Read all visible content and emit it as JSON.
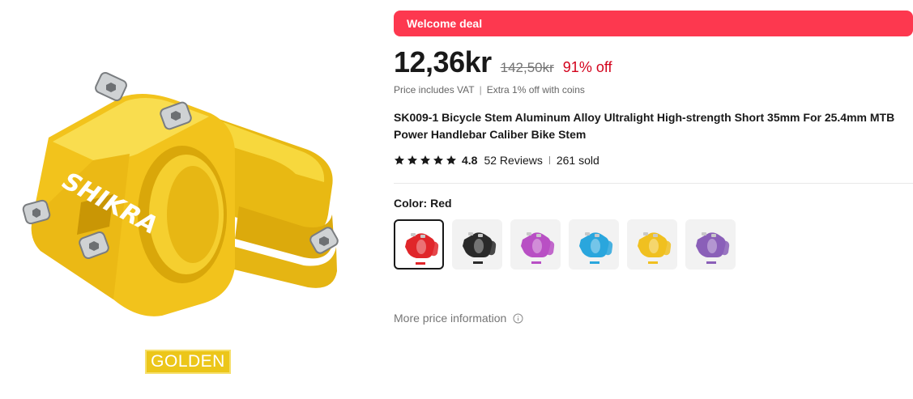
{
  "product": {
    "image_label": "GOLDEN",
    "brand_mark": "SHIKRA"
  },
  "promo": {
    "banner": "Welcome deal"
  },
  "price": {
    "current": "12,36kr",
    "original": "142,50kr",
    "discount": "91% off",
    "vat_note": "Price includes VAT",
    "separator": "|",
    "coins_note": "Extra 1% off with coins"
  },
  "title": "SK009-1 Bicycle Stem Aluminum Alloy Ultralight High-strength Short 35mm For 25.4mm MTB Power Handlebar Caliber Bike Stem",
  "rating": {
    "stars": 5,
    "value": "4.8",
    "reviews": "52 Reviews",
    "sold": "261 sold"
  },
  "color": {
    "label": "Color: Red",
    "options": [
      {
        "name": "red",
        "hex": "#e0262a",
        "selected": true
      },
      {
        "name": "black",
        "hex": "#2a2a2a",
        "selected": false
      },
      {
        "name": "purple",
        "hex": "#b84fc4",
        "selected": false
      },
      {
        "name": "blue",
        "hex": "#2aa6dd",
        "selected": false
      },
      {
        "name": "gold",
        "hex": "#f0c020",
        "selected": false
      },
      {
        "name": "rainbow",
        "hex": "#8a5fb8",
        "selected": false
      }
    ]
  },
  "more_price": {
    "label": "More price information"
  },
  "colors": {
    "accent": "#fd384f",
    "discount": "#d3031c",
    "product_gold": "#f2c31c"
  }
}
